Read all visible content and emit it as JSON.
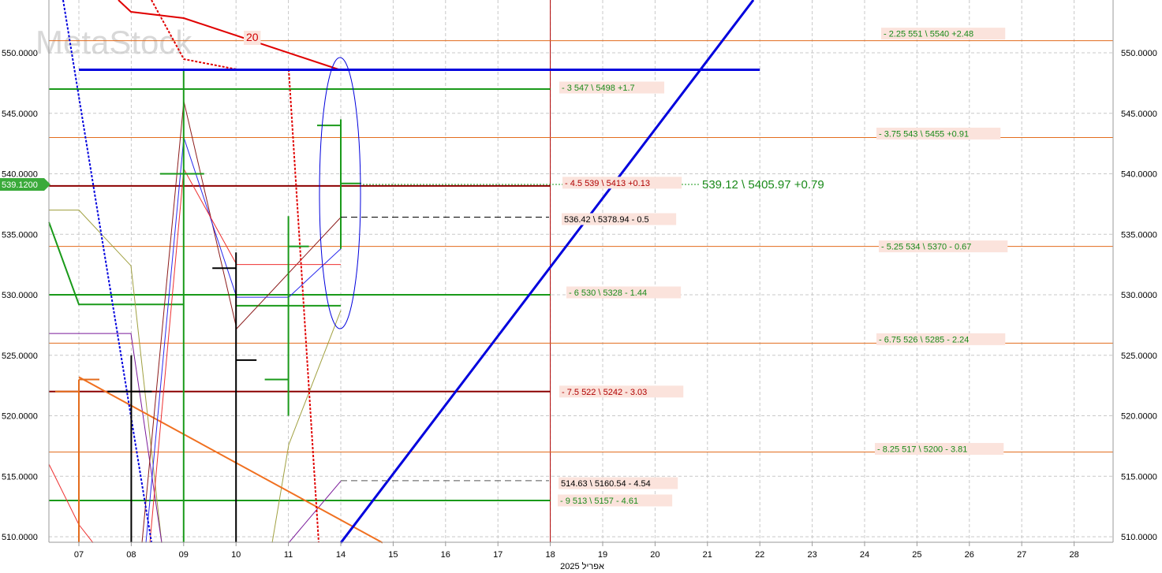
{
  "chart_data": {
    "type": "candlestick",
    "watermark": "MetaStock",
    "x_axis": {
      "ticks": [
        "07",
        "08",
        "09",
        "10",
        "11",
        "14",
        "15",
        "16",
        "17",
        "18",
        "19",
        "20",
        "21",
        "22",
        "23",
        "24",
        "25",
        "26",
        "27",
        "28"
      ],
      "month_label": "אפריל 2025"
    },
    "y_axis": {
      "range": [
        509.5,
        552
      ],
      "ticks": [
        "510.0000",
        "515.0000",
        "520.0000",
        "525.0000",
        "530.0000",
        "535.0000",
        "540.0000",
        "545.0000",
        "550.0000"
      ],
      "last_price_label": "539.1200",
      "last_price": 539.12
    },
    "bars": [
      {
        "date": "07",
        "open": 522,
        "high": 523,
        "low": 509.5,
        "close": 523,
        "color": "#e36c1d"
      },
      {
        "date": "08",
        "open": 522,
        "high": 525,
        "low": 509.5,
        "close": 522,
        "color": "#000000"
      },
      {
        "date": "09",
        "open": 540,
        "high": 548.5,
        "low": 509.5,
        "close": 540,
        "color": "#1a9a1a"
      },
      {
        "date": "10",
        "open": 532.2,
        "high": 533.5,
        "low": 509.5,
        "close": 524.6,
        "color": "#000000"
      },
      {
        "date": "11",
        "open": 523,
        "high": 536.5,
        "low": 520,
        "close": 534,
        "color": "#1a9a1a"
      },
      {
        "date": "14",
        "open": 544,
        "high": 544.5,
        "low": 533.8,
        "close": 539.2,
        "color": "#1a9a1a"
      }
    ],
    "levels": [
      {
        "price": 551,
        "label": "- 2.25  551 \\ 5540  +2.48",
        "color": "#e36c1d",
        "label_color": "#1a8a1a"
      },
      {
        "price": 547,
        "label": "- 3  547 \\ 5498  +1.7",
        "color": "#1a9a1a",
        "label_color": "#1a8a1a"
      },
      {
        "price": 543,
        "label": "- 3.75  543 \\ 5455  +0.91",
        "color": "#e36c1d",
        "label_color": "#1a8a1a"
      },
      {
        "price": 539,
        "label": "- 4.5  539 \\ 5413  +0.13",
        "color": "#8b0000",
        "label_color": "#b00000"
      },
      {
        "price": 534,
        "label": "- 5.25  534 \\ 5370  - 0.67",
        "color": "#e36c1d",
        "label_color": "#1a8a1a"
      },
      {
        "price": 530,
        "label": "- 6  530 \\ 5328  - 1.44",
        "color": "#1a9a1a",
        "label_color": "#1a8a1a"
      },
      {
        "price": 526,
        "label": "- 6.75  526 \\ 5285  - 2.24",
        "color": "#e36c1d",
        "label_color": "#1a8a1a"
      },
      {
        "price": 522,
        "label": "- 7.5  522 \\ 5242  - 3.03",
        "color": "#8b0000",
        "label_color": "#b00000"
      },
      {
        "price": 517,
        "label": "- 8.25  517 \\ 5200  - 3.81",
        "color": "#e36c1d",
        "label_color": "#1a8a1a"
      },
      {
        "price": 513,
        "label": "- 9  513 \\ 5157  - 4.61",
        "color": "#1a9a1a",
        "label_color": "#1a8a1a"
      }
    ],
    "annotations": [
      {
        "price": 539.12,
        "text": "539.12 \\ 5405.97  +0.79",
        "color": "#1a8a1a"
      },
      {
        "price": 536.42,
        "text": "536.42 \\ 5378.94  - 0.5",
        "color": "#000000"
      },
      {
        "price": 514.63,
        "text": "514.63 \\ 5160.54  - 4.54",
        "color": "#000000"
      },
      {
        "price": 550.3,
        "text": "20",
        "color": "#d00000"
      }
    ],
    "trendline_blue": {
      "from": {
        "date": "14",
        "price": 509.5
      },
      "to": {
        "date": "21.8",
        "price": 552
      }
    },
    "horizontal_blue": {
      "price": 548.6,
      "from": "07",
      "to": "22"
    },
    "colors": {
      "grid": "#c8c8c8",
      "blue": "#0000dd",
      "red": "#e00000",
      "green": "#1a9a1a",
      "orange": "#f07020",
      "darkred": "#8b0000"
    }
  }
}
